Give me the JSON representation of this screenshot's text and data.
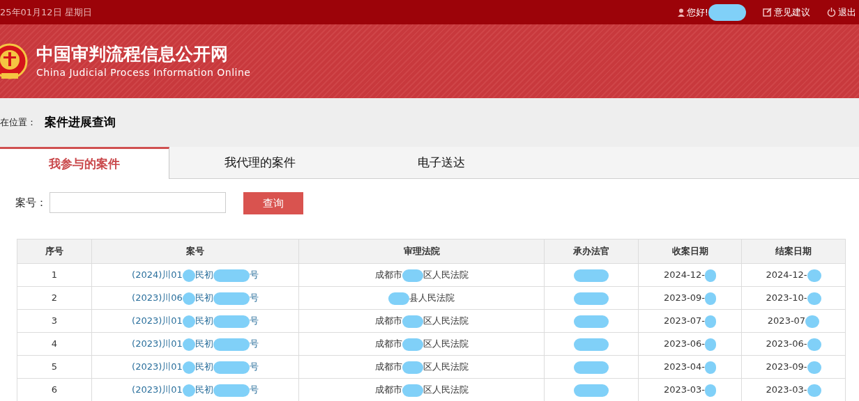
{
  "top_bar": {
    "date": "25年01月12日 星期日",
    "greeting": "您好!",
    "user_redacted": true,
    "links": [
      {
        "kind": "feedback",
        "label": "意见建议"
      },
      {
        "kind": "logout",
        "label": "退出"
      }
    ]
  },
  "header": {
    "title": "中国审判流程信息公开网",
    "subtitle": "China Judicial Process Information Online"
  },
  "breadcrumb": {
    "label": "在位置：",
    "current": "案件进展查询"
  },
  "tabs": [
    {
      "label": "我参与的案件",
      "selected": true
    },
    {
      "label": "我代理的案件",
      "selected": false
    },
    {
      "label": "电子送达",
      "selected": false
    }
  ],
  "search": {
    "label": "案号：",
    "button": "查询"
  },
  "table": {
    "columns": [
      "序号",
      "案号",
      "审理法院",
      "承办法官",
      "收案日期",
      "结案日期"
    ],
    "rows": [
      {
        "index": "1",
        "case_number": [
          {
            "kind": "text",
            "text": "(2024)川01"
          },
          {
            "kind": "redaction"
          },
          {
            "kind": "text",
            "text": "民初"
          },
          {
            "kind": "redaction"
          },
          {
            "kind": "text",
            "text": "号"
          }
        ],
        "court": [
          {
            "kind": "text",
            "text": "成都市"
          },
          {
            "kind": "redaction"
          },
          {
            "kind": "text",
            "text": "区人民法院"
          }
        ],
        "judge": [
          {
            "kind": "redaction"
          }
        ],
        "filed": [
          {
            "kind": "text",
            "text": "2024-12-"
          },
          {
            "kind": "redaction"
          }
        ],
        "closed": [
          {
            "kind": "text",
            "text": "2024-12-"
          },
          {
            "kind": "redaction"
          }
        ]
      },
      {
        "index": "2",
        "case_number": [
          {
            "kind": "text",
            "text": "(2023)川06"
          },
          {
            "kind": "redaction"
          },
          {
            "kind": "text",
            "text": "民初"
          },
          {
            "kind": "redaction"
          },
          {
            "kind": "text",
            "text": "号"
          }
        ],
        "court": [
          {
            "kind": "redaction"
          },
          {
            "kind": "text",
            "text": "县人民法院"
          }
        ],
        "judge": [
          {
            "kind": "redaction"
          }
        ],
        "filed": [
          {
            "kind": "text",
            "text": "2023-09-"
          },
          {
            "kind": "redaction"
          }
        ],
        "closed": [
          {
            "kind": "text",
            "text": "2023-10-"
          },
          {
            "kind": "redaction"
          }
        ]
      },
      {
        "index": "3",
        "case_number": [
          {
            "kind": "text",
            "text": "(2023)川01"
          },
          {
            "kind": "redaction"
          },
          {
            "kind": "text",
            "text": "民初"
          },
          {
            "kind": "redaction"
          },
          {
            "kind": "text",
            "text": "号"
          }
        ],
        "court": [
          {
            "kind": "text",
            "text": "成都市"
          },
          {
            "kind": "redaction"
          },
          {
            "kind": "text",
            "text": "区人民法院"
          }
        ],
        "judge": [
          {
            "kind": "redaction"
          }
        ],
        "filed": [
          {
            "kind": "text",
            "text": "2023-07-"
          },
          {
            "kind": "redaction"
          }
        ],
        "closed": [
          {
            "kind": "text",
            "text": "2023-07"
          },
          {
            "kind": "redaction"
          }
        ]
      },
      {
        "index": "4",
        "case_number": [
          {
            "kind": "text",
            "text": "(2023)川01"
          },
          {
            "kind": "redaction"
          },
          {
            "kind": "text",
            "text": "民初"
          },
          {
            "kind": "redaction"
          },
          {
            "kind": "text",
            "text": "号"
          }
        ],
        "court": [
          {
            "kind": "text",
            "text": "成都市"
          },
          {
            "kind": "redaction"
          },
          {
            "kind": "text",
            "text": "区人民法院"
          }
        ],
        "judge": [
          {
            "kind": "redaction"
          }
        ],
        "filed": [
          {
            "kind": "text",
            "text": "2023-06-"
          },
          {
            "kind": "redaction"
          }
        ],
        "closed": [
          {
            "kind": "text",
            "text": "2023-06-"
          },
          {
            "kind": "redaction"
          }
        ]
      },
      {
        "index": "5",
        "case_number": [
          {
            "kind": "text",
            "text": "(2023)川01"
          },
          {
            "kind": "redaction"
          },
          {
            "kind": "text",
            "text": "民初"
          },
          {
            "kind": "redaction"
          },
          {
            "kind": "text",
            "text": "号"
          }
        ],
        "court": [
          {
            "kind": "text",
            "text": "成都市"
          },
          {
            "kind": "redaction"
          },
          {
            "kind": "text",
            "text": "区人民法院"
          }
        ],
        "judge": [
          {
            "kind": "redaction"
          }
        ],
        "filed": [
          {
            "kind": "text",
            "text": "2023-04-"
          },
          {
            "kind": "redaction"
          }
        ],
        "closed": [
          {
            "kind": "text",
            "text": "2023-09-"
          },
          {
            "kind": "redaction"
          }
        ]
      },
      {
        "index": "6",
        "case_number": [
          {
            "kind": "text",
            "text": "(2023)川01"
          },
          {
            "kind": "redaction"
          },
          {
            "kind": "text",
            "text": "民初"
          },
          {
            "kind": "redaction"
          },
          {
            "kind": "text",
            "text": "号"
          }
        ],
        "court": [
          {
            "kind": "text",
            "text": "成都市"
          },
          {
            "kind": "redaction"
          },
          {
            "kind": "text",
            "text": "区人民法院"
          }
        ],
        "judge": [
          {
            "kind": "redaction"
          }
        ],
        "filed": [
          {
            "kind": "text",
            "text": "2023-03-"
          },
          {
            "kind": "redaction"
          }
        ],
        "closed": [
          {
            "kind": "text",
            "text": "2023-03-"
          },
          {
            "kind": "redaction"
          }
        ]
      }
    ]
  }
}
